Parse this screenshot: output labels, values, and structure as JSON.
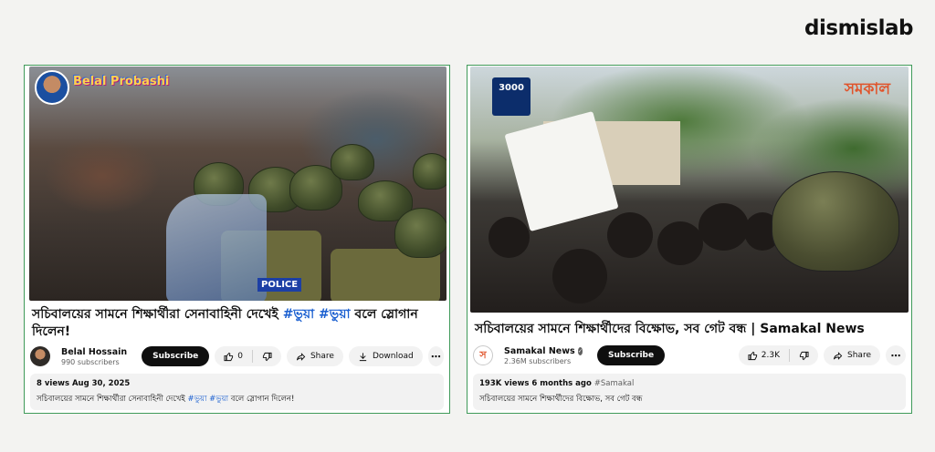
{
  "brand": {
    "logo": "dismislab"
  },
  "left": {
    "overlay_channel": "Belal Probashi",
    "title_part1": "সচিবালয়ের সামনে শিক্ষার্থীরা সেনাবাহিনী দেখেই ",
    "hashtag1": "#ভুয়া",
    "hashtag2": "#ভুয়া",
    "title_part2": " বলে স্লোগান",
    "title_line2": "দিলেন!",
    "channel_name": "Belal Hossain",
    "subscribers": "990 subscribers",
    "subscribe_label": "Subscribe",
    "likes": "0",
    "share_label": "Share",
    "download_label": "Download",
    "views_date": "8 views  Aug 30, 2025",
    "desc_part1": "সচিবালয়ের সামনে শিক্ষার্থীরা সেনাবাহিনী দেখেই ",
    "desc_tag1": "#ভুয়া",
    "desc_tag2": "#ভুয়া",
    "desc_part2": " বলে স্লোগান দিলেন!",
    "police_text": "POLICE"
  },
  "right": {
    "overlay_brand": "সমকাল",
    "counter_badge": "3000",
    "title": "সচিবালয়ের সামনে শিক্ষার্থীদের বিক্ষোভ, সব গেট বন্ধ | Samakal News",
    "channel_name": "Samakal News",
    "subscribers": "2.36M subscribers",
    "subscribe_label": "Subscribe",
    "likes": "2.3K",
    "share_label": "Share",
    "views_date": "193K views  6 months ago",
    "hashtag": "#Samakal",
    "description": "সচিবালয়ের সামনে শিক্ষার্থীদের বিক্ষোভ, সব গেট বন্ধ",
    "avatar_letter": "স"
  },
  "icons": {
    "like": "thumbs-up-icon",
    "dislike": "thumbs-down-icon",
    "share": "share-arrow-icon",
    "download": "download-arrow-icon",
    "more": "more-horizontal-icon",
    "verified": "verified-check-icon"
  }
}
